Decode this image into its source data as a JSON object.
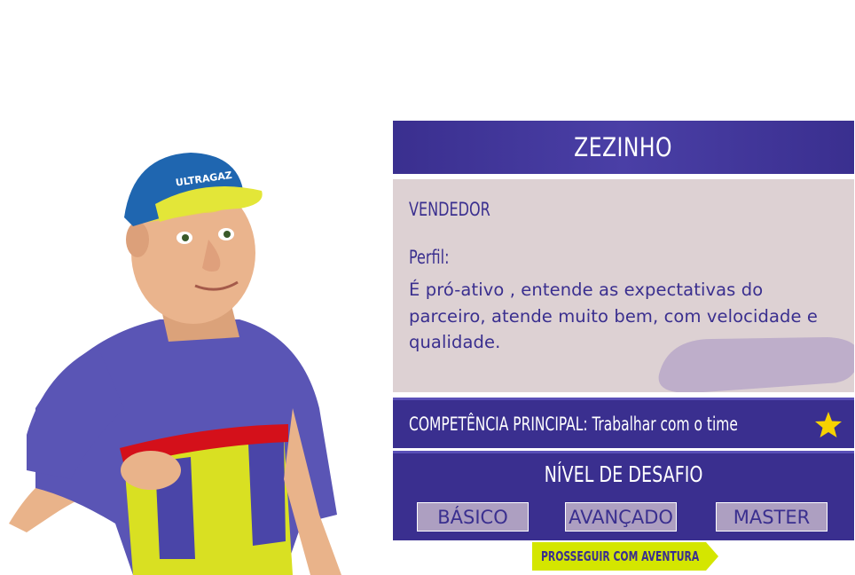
{
  "character": {
    "name": "ZEZINHO",
    "role": "VENDEDOR",
    "profile_label": "Perfil:",
    "profile_text": "É pró-ativo , entende as expectativas do parceiro, atende muito bem, com velocidade e qualidade.",
    "cap_logo": "ULTRAGAZ"
  },
  "competencia": {
    "text": "COMPETÊNCIA PRINCIPAL: Trabalhar com o time"
  },
  "nivel": {
    "title": "NÍVEL DE DESAFIO",
    "levels": [
      "BÁSICO",
      "AVANÇADO",
      "MASTER"
    ]
  },
  "proceed_button": {
    "label": "PROSSEGUIR COM AVENTURA"
  },
  "colors": {
    "primary": "#3a2f8f",
    "panel": "#ddd1d3",
    "button": "#ad9fc1",
    "proceed": "#d4e600",
    "star": "#f7d200"
  },
  "icons": [
    "star-icon",
    "arrow-right-icon"
  ]
}
